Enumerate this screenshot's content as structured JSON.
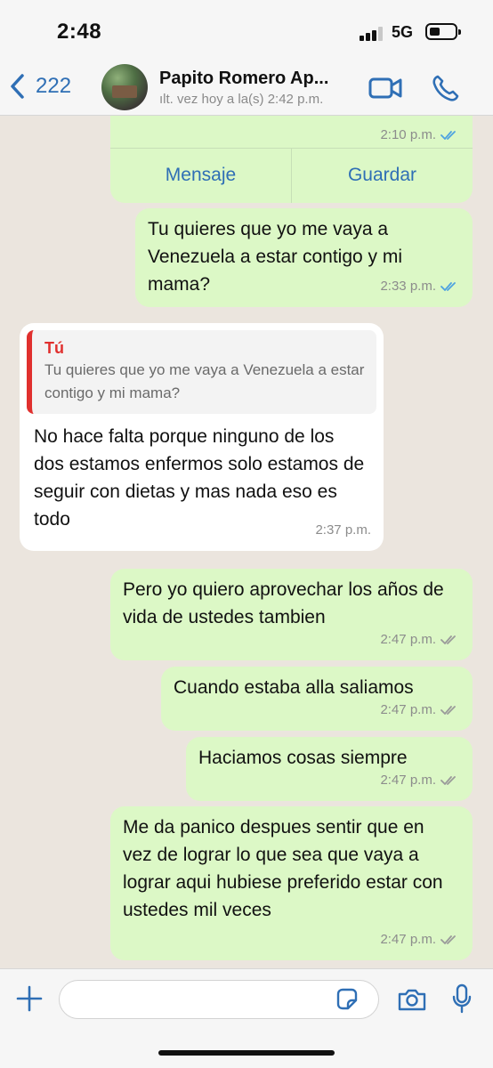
{
  "status_bar": {
    "time": "2:48",
    "network": "5G",
    "signal_icon": "cellular-signal-icon",
    "battery_icon": "battery-icon"
  },
  "header": {
    "back_count": "222",
    "contact_name": "Papito Romero Ap...",
    "contact_status": "ılt. vez hoy a la(s) 2:42 p.m.",
    "icons": [
      "chevron-left-icon",
      "video-camera-icon",
      "phone-icon"
    ]
  },
  "chat": {
    "card": {
      "time": "2:10 p.m.",
      "button_left": "Mensaje",
      "button_right": "Guardar",
      "read": true
    },
    "messages": [
      {
        "direction": "out",
        "text": "Tu quieres que yo me vaya a Venezuela a estar contigo y mi mama?",
        "time": "2:33 p.m.",
        "read": true
      },
      {
        "direction": "in",
        "quote_author": "Tú",
        "quote_text": "Tu quieres que yo me vaya a Venezuela a estar contigo y mi mama?",
        "text": "No hace falta porque ninguno de los dos estamos enfermos solo estamos de seguir con dietas y mas nada eso es  todo",
        "time": "2:37 p.m."
      },
      {
        "direction": "out",
        "text": "Pero yo quiero aprovechar los años de vida de ustedes tambien",
        "time": "2:47 p.m.",
        "read": false
      },
      {
        "direction": "out",
        "text": "Cuando estaba alla saliamos",
        "time": "2:47 p.m.",
        "read": false
      },
      {
        "direction": "out",
        "text": "Haciamos cosas siempre",
        "time": "2:47 p.m.",
        "read": false
      },
      {
        "direction": "out",
        "text": "Me da panico despues sentir que en vez de lograr lo que sea que vaya a lograr aqui hubiese preferido estar con ustedes mil veces",
        "time": "2:47 p.m.",
        "read": false
      }
    ]
  },
  "input_bar": {
    "placeholder": "",
    "icons": [
      "plus-icon",
      "sticker-icon",
      "camera-icon",
      "microphone-icon"
    ]
  },
  "colors": {
    "accent": "#2f6fb5",
    "outgoing_bubble": "#dcf8c6",
    "incoming_bubble": "#ffffff",
    "chat_background": "#ebe5de",
    "read_ticks": "#4fa3e0",
    "unread_ticks": "#9a9a9a",
    "quote_author": "#e0302e"
  }
}
